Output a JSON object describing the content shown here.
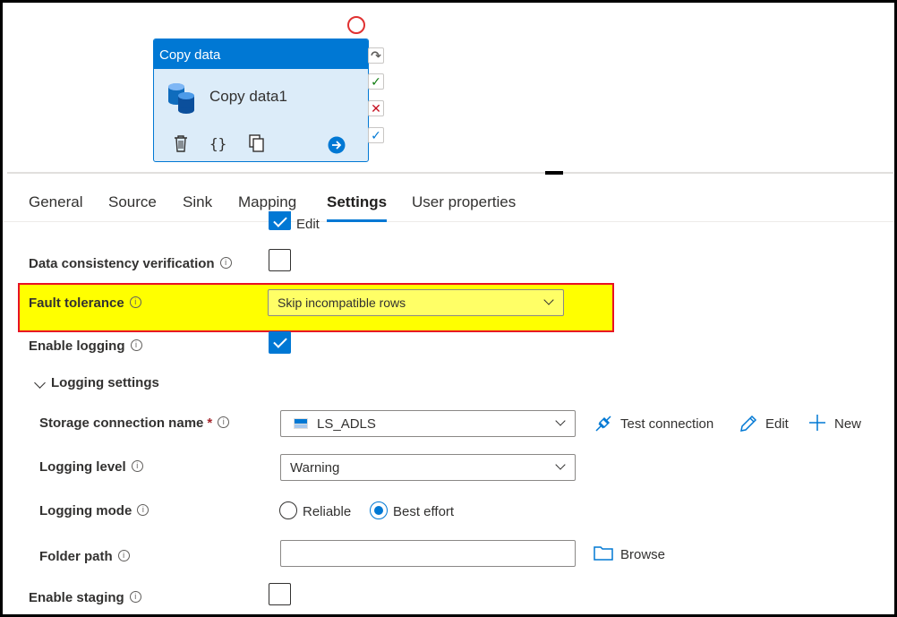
{
  "activity": {
    "type_title": "Copy data",
    "name": "Copy data1"
  },
  "tabs": [
    {
      "label": "General"
    },
    {
      "label": "Source"
    },
    {
      "label": "Sink"
    },
    {
      "label": "Mapping"
    },
    {
      "label": "Settings"
    },
    {
      "label": "User properties"
    }
  ],
  "form": {
    "edit_checkbox_label": "Edit",
    "data_consistency": {
      "label": "Data consistency verification",
      "checked": false
    },
    "fault_tolerance": {
      "label": "Fault tolerance",
      "value": "Skip incompatible rows"
    },
    "enable_logging": {
      "label": "Enable logging",
      "checked": true
    },
    "logging_settings": {
      "label": "Logging settings",
      "expanded": true
    },
    "storage_connection": {
      "label": "Storage connection name",
      "required_mark": "*",
      "value": "LS_ADLS",
      "test_connection": "Test connection",
      "edit": "Edit",
      "new": "New"
    },
    "logging_level": {
      "label": "Logging level",
      "value": "Warning"
    },
    "logging_mode": {
      "label": "Logging mode",
      "options": [
        {
          "label": "Reliable",
          "selected": false
        },
        {
          "label": "Best effort",
          "selected": true
        }
      ]
    },
    "folder_path": {
      "label": "Folder path",
      "value": "",
      "browse": "Browse"
    },
    "enable_staging": {
      "label": "Enable staging",
      "checked": false
    }
  },
  "colors": {
    "accent": "#0078d4",
    "highlight": "#ffff00",
    "highlight_border": "#e81123",
    "success": "#107c10",
    "failure": "#c50f1f"
  }
}
